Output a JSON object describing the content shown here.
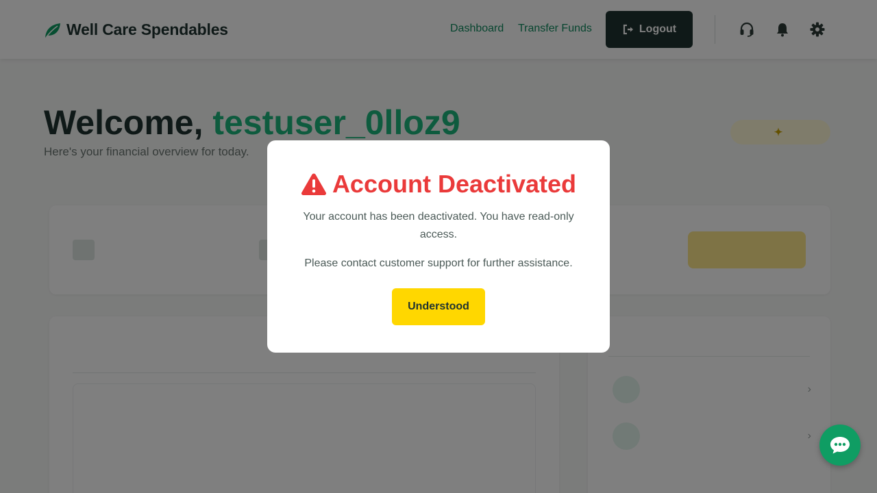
{
  "header": {
    "brand": "Well Care Spendables",
    "nav": {
      "dashboard": "Dashboard",
      "transfer": "Transfer Funds"
    },
    "logout_label": "Logout",
    "icons": [
      "headset-icon",
      "bell-icon",
      "gear-icon"
    ]
  },
  "page": {
    "welcome_prefix": "Welcome,",
    "username": "testuser_0lloz9",
    "overview": "Here's your financial overview for today."
  },
  "modal": {
    "title": "Account Deactivated",
    "message": "Your account has been deactivated. You have read-only access.",
    "support": "Please contact customer support for further assistance.",
    "button": "Understood"
  },
  "colors": {
    "brand": "#1f3330",
    "accent_green": "#0f9d63",
    "warning_red": "#ea3a3a",
    "button_yellow": "#ffd700"
  }
}
